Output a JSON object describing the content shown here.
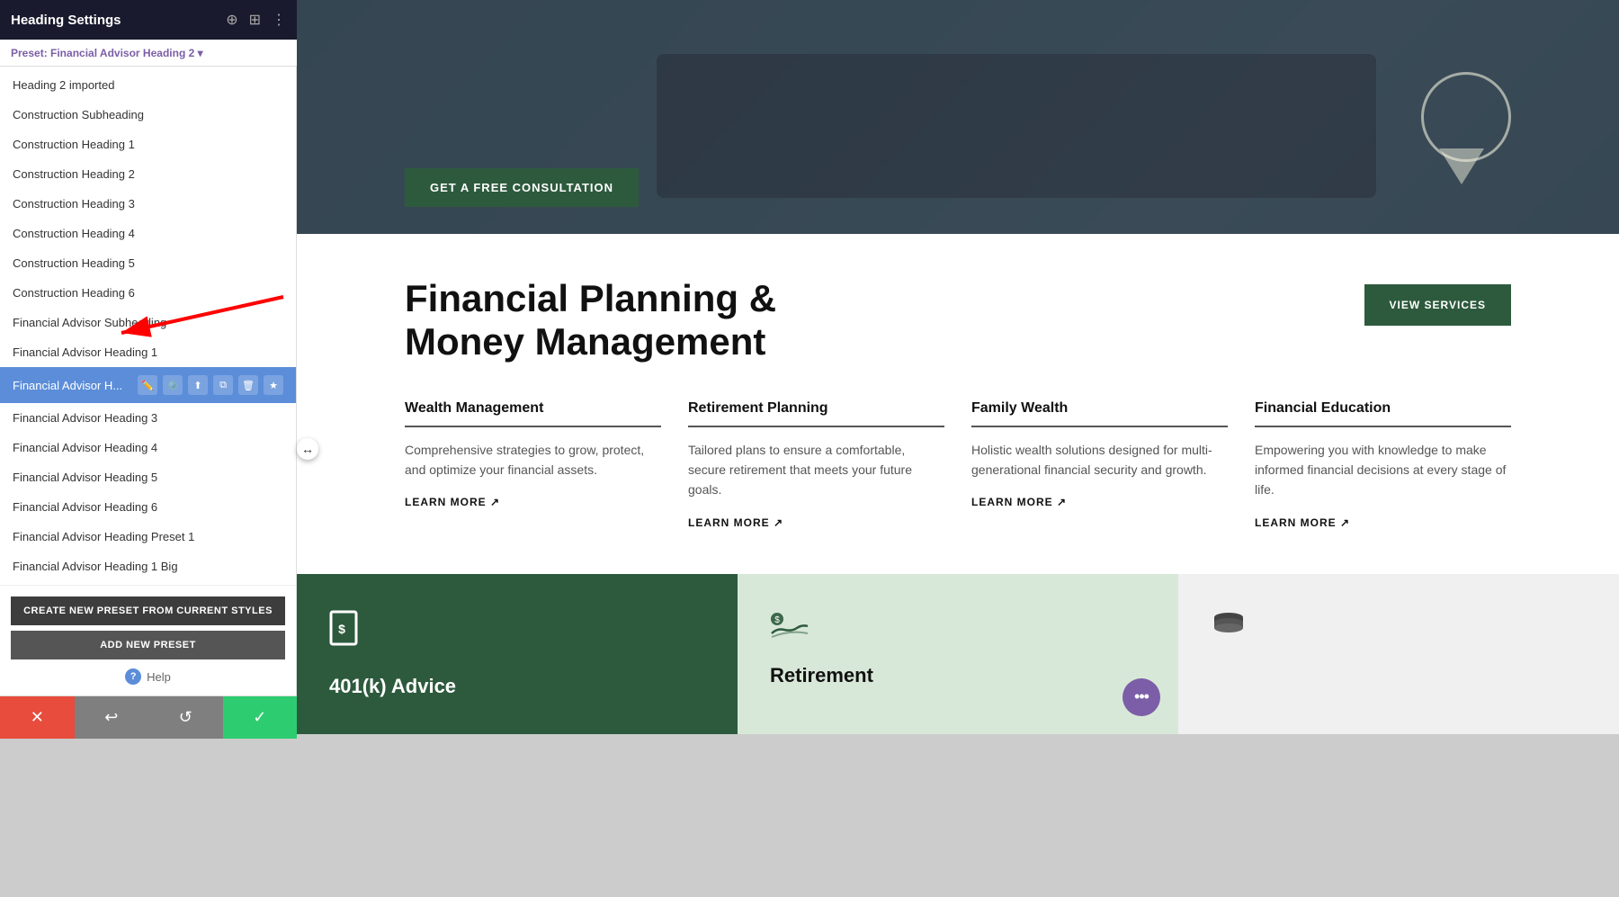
{
  "topBar": {
    "title": "Heading Settings",
    "icons": [
      "target",
      "layout",
      "more"
    ]
  },
  "presetBar": {
    "label": "Preset: Financial Advisor Heading 2 ▾"
  },
  "sidebar": {
    "items": [
      {
        "id": "heading2-imported",
        "label": "Heading 2 imported",
        "active": false
      },
      {
        "id": "construction-subheading",
        "label": "Construction Subheading",
        "active": false
      },
      {
        "id": "construction-heading-1",
        "label": "Construction Heading 1",
        "active": false
      },
      {
        "id": "construction-heading-2",
        "label": "Construction Heading 2",
        "active": false
      },
      {
        "id": "construction-heading-3",
        "label": "Construction Heading 3",
        "active": false
      },
      {
        "id": "construction-heading-4",
        "label": "Construction Heading 4",
        "active": false
      },
      {
        "id": "construction-heading-5",
        "label": "Construction Heading 5",
        "active": false
      },
      {
        "id": "construction-heading-6",
        "label": "Construction Heading 6",
        "active": false
      },
      {
        "id": "financial-advisor-subheading",
        "label": "Financial Advisor Subheading",
        "active": false
      },
      {
        "id": "financial-advisor-heading-1",
        "label": "Financial Advisor Heading 1",
        "active": false
      },
      {
        "id": "financial-advisor-heading-2",
        "label": "Financial Advisor H...",
        "active": true
      },
      {
        "id": "financial-advisor-heading-3",
        "label": "Financial Advisor Heading 3",
        "active": false
      },
      {
        "id": "financial-advisor-heading-4",
        "label": "Financial Advisor Heading 4",
        "active": false
      },
      {
        "id": "financial-advisor-heading-5",
        "label": "Financial Advisor Heading 5",
        "active": false
      },
      {
        "id": "financial-advisor-heading-6",
        "label": "Financial Advisor Heading 6",
        "active": false
      },
      {
        "id": "financial-advisor-preset-1",
        "label": "Financial Advisor Heading Preset 1",
        "active": false
      },
      {
        "id": "financial-advisor-big",
        "label": "Financial Advisor Heading 1 Big",
        "active": false
      }
    ],
    "activeActions": [
      "edit",
      "settings",
      "upload",
      "copy",
      "delete",
      "star"
    ],
    "createPresetBtn": "CREATE NEW PRESET FROM CURRENT STYLES",
    "addPresetBtn": "ADD NEW PRESET",
    "helpLabel": "Help"
  },
  "bottomBar": {
    "cancelLabel": "✕",
    "undoLabel": "↩",
    "redoLabel": "↺",
    "confirmLabel": "✓"
  },
  "hero": {
    "btnLabel": "GET A FREE CONSULTATION"
  },
  "services": {
    "title": "Financial Planning &\nMoney Management",
    "viewServicesBtn": "VIEW SERVICES",
    "items": [
      {
        "title": "Wealth Management",
        "text": "Comprehensive strategies to grow, protect, and optimize your financial assets.",
        "link": "LEARN MORE ↗"
      },
      {
        "title": "Retirement Planning",
        "text": "Tailored plans to ensure a comfortable, secure retirement that meets your future goals.",
        "link": "LEARN MORE ↗"
      },
      {
        "title": "Family Wealth",
        "text": "Holistic wealth solutions designed for multi-generational financial security and growth.",
        "link": "LEARN MORE ↗"
      },
      {
        "title": "Financial Education",
        "text": "Empowering you with knowledge to make informed financial decisions at every stage of life.",
        "link": "LEARN MORE ↗"
      }
    ]
  },
  "cards": [
    {
      "id": "card-1",
      "icon": "📄",
      "title": "401(k) Advice",
      "theme": "dark"
    },
    {
      "id": "card-2",
      "icon": "💵",
      "title": "Retirement",
      "theme": "light"
    },
    {
      "id": "card-3",
      "icon": "💰",
      "title": "",
      "theme": "white"
    }
  ]
}
